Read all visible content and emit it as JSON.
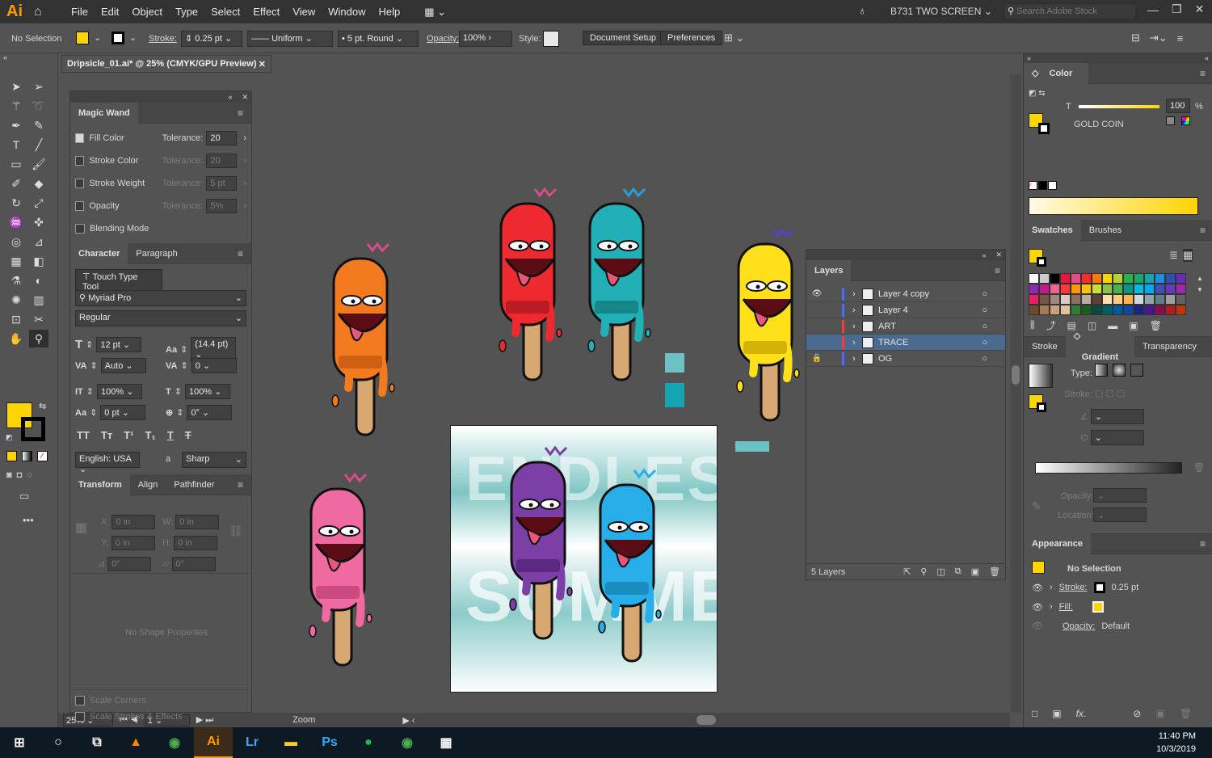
{
  "app": {
    "logo": "Ai",
    "workspace": "B731 TWO SCREEN",
    "search_placeholder": "Search Adobe Stock"
  },
  "menu": [
    "File",
    "Edit",
    "Object",
    "Type",
    "Select",
    "Effect",
    "View",
    "Window",
    "Help"
  ],
  "control": {
    "selection": "No Selection",
    "stroke_label": "Stroke:",
    "stroke_value": "0.25 pt",
    "profile": "Uniform",
    "brush": "5 pt. Round",
    "opacity_label": "Opacity:",
    "opacity_value": "100%",
    "style_label": "Style:",
    "doc_setup": "Document Setup",
    "preferences": "Preferences",
    "fill_color": "#ffd400"
  },
  "document": {
    "tab": "Dripsicle_01.ai* @ 25% (CMYK/GPU Preview)",
    "zoom": "25%",
    "page": "1",
    "status": "Zoom"
  },
  "magic_wand": {
    "title": "Magic Wand",
    "rows": [
      {
        "label": "Fill Color",
        "checked": true,
        "tol_label": "Tolerance:",
        "tol": "20"
      },
      {
        "label": "Stroke Color",
        "checked": false,
        "tol_label": "Tolerance:",
        "tol": "20"
      },
      {
        "label": "Stroke Weight",
        "checked": false,
        "tol_label": "Tolerance:",
        "tol": "5 pt"
      },
      {
        "label": "Opacity",
        "checked": false,
        "tol_label": "Tolerance:",
        "tol": "5%"
      },
      {
        "label": "Blending Mode",
        "checked": false
      }
    ]
  },
  "character": {
    "tabs": [
      "Character",
      "Paragraph"
    ],
    "touch": "Touch Type Tool",
    "font": "Myriad Pro",
    "style": "Regular",
    "size": "12 pt",
    "leading": "(14.4 pt)",
    "kerning": "Auto",
    "tracking": "0",
    "vscale": "100%",
    "hscale": "100%",
    "baseline": "0 pt",
    "rotation": "0°",
    "language": "English: USA",
    "antialias": "Sharp",
    "aa_glyph": "a"
  },
  "transform": {
    "tabs": [
      "Transform",
      "Align",
      "Pathfinder"
    ],
    "x": "0 in",
    "y": "0 in",
    "w": "0 in",
    "h": "0 in",
    "angle": "0°",
    "shear": "0°",
    "empty": "No Shape Properties",
    "scale_corners": "Scale Corners",
    "scale_strokes": "Scale Strokes & Effects"
  },
  "layers": {
    "title": "Layers",
    "items": [
      {
        "name": "Layer 4 copy",
        "color": "#4f6bff"
      },
      {
        "name": "Layer 4",
        "color": "#4f6bff"
      },
      {
        "name": "ART",
        "color": "#ff3a3a"
      },
      {
        "name": "TRACE",
        "color": "#ff3a3a"
      },
      {
        "name": "OG",
        "color": "#4f6bff"
      }
    ],
    "count": "5 Layers"
  },
  "color_panel": {
    "title": "Color",
    "tint_label": "T",
    "tint": "100",
    "pct": "%",
    "swatch_name": "GOLD COIN"
  },
  "swatches": {
    "tabs": [
      "Swatches",
      "Brushes"
    ]
  },
  "gradient": {
    "tabs": [
      "Stroke",
      "Gradient",
      "Transparency"
    ],
    "type": "Type:",
    "stroke": "Stroke:",
    "opacity": "Opacity:",
    "location": "Location:"
  },
  "appearance": {
    "title": "Appearance",
    "selection": "No Selection",
    "stroke_label": "Stroke:",
    "stroke_value": "0.25 pt",
    "fill_label": "Fill:",
    "opacity_label": "Opacity:",
    "opacity_value": "Default"
  },
  "artboard": {
    "text1": "ENDLESS",
    "text2": "SUMMER"
  },
  "taskbar": {
    "time": "11:40 PM",
    "date": "10/3/2019"
  }
}
